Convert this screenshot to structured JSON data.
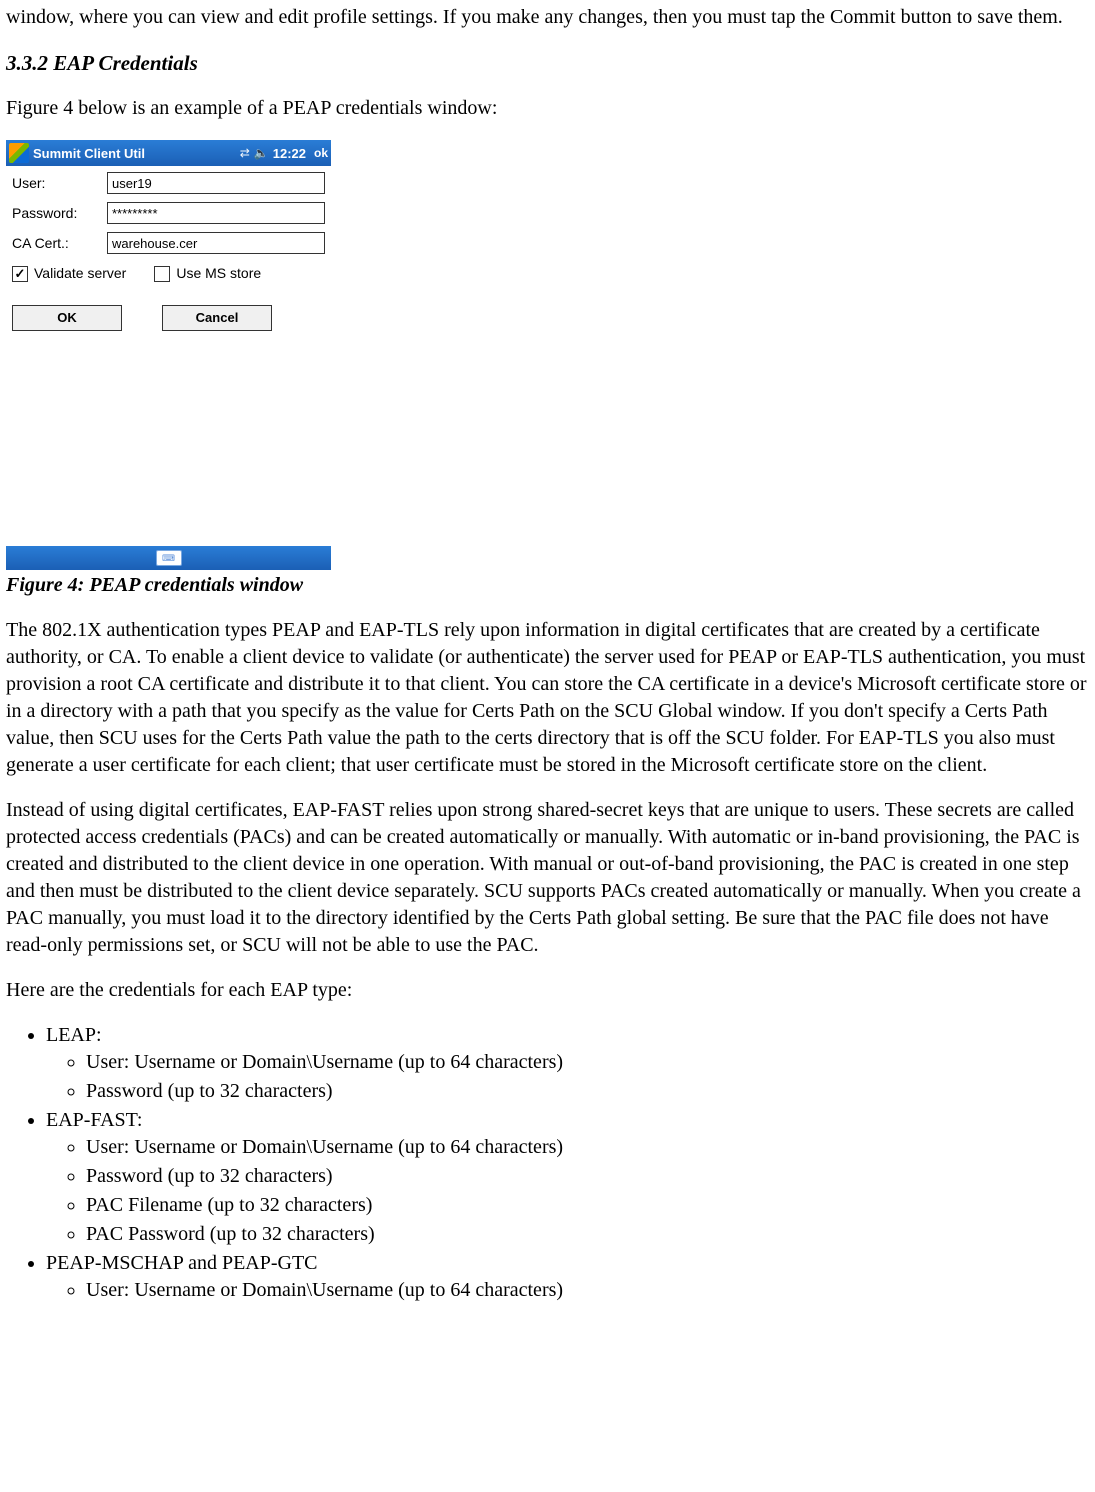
{
  "intro_para": "window, where you can view and edit profile settings. If you make any changes, then you must tap the Commit button to save them.",
  "section_heading": "3.3.2 EAP Credentials",
  "fig_intro": "Figure 4 below is an example of a PEAP credentials window:",
  "figure_caption": "Figure 4: PEAP credentials window",
  "screenshot": {
    "title": "Summit Client Util",
    "time": "12:22",
    "ok_label": "ok",
    "user_label": "User:",
    "user_value": "user19",
    "password_label": "Password:",
    "password_value": "*********",
    "cacert_label": "CA Cert.:",
    "cacert_value": "warehouse.cer",
    "validate_label": "Validate server",
    "validate_checked": true,
    "msstore_label": "Use MS store",
    "msstore_checked": false,
    "ok_button": "OK",
    "cancel_button": "Cancel"
  },
  "para_cert": "The 802.1X authentication types PEAP and EAP-TLS rely upon information in digital certificates that are created by a certificate authority, or CA. To enable a client device to validate (or authenticate) the server used for PEAP or EAP-TLS authentication, you must provision a root CA certificate and distribute it to that client. You can store the CA certificate in a device's Microsoft certificate store or in a directory with a path that you specify as the value for Certs Path on the SCU Global window. If you don't specify a Certs Path value, then SCU uses for the Certs Path value the path to the certs directory that is off the SCU folder. For EAP-TLS you also must generate a user certificate for each client; that user certificate must be stored in the Microsoft certificate store on the client.",
  "para_pac": "Instead of using digital certificates, EAP-FAST relies upon strong shared-secret keys that are unique to users. These secrets are called protected access credentials (PACs) and can be created automatically or manually.  With automatic or in-band provisioning, the PAC is created and distributed to the client device in one operation. With manual or out-of-band provisioning, the PAC is created in one step and then must be distributed to the client device separately. SCU supports PACs created automatically or manually. When you create a PAC manually, you must load it to the directory identified by the Certs Path global setting. Be sure that the PAC file does not have read-only permissions set, or SCU will not be able to use the PAC.",
  "cred_intro": "Here are the credentials for each EAP type:",
  "list": {
    "leap": {
      "label": "LEAP:",
      "items": [
        "User: Username or Domain\\Username (up to 64 characters)",
        "Password (up to 32 characters)"
      ]
    },
    "eapfast": {
      "label": "EAP-FAST:",
      "items": [
        "User: Username or Domain\\Username (up to 64 characters)",
        "Password (up to 32 characters)",
        "PAC Filename (up to 32 characters)",
        "PAC Password (up to 32 characters)"
      ]
    },
    "peap": {
      "label": "PEAP-MSCHAP and PEAP-GTC",
      "items": [
        "User: Username or Domain\\Username (up to 64 characters)"
      ]
    }
  }
}
